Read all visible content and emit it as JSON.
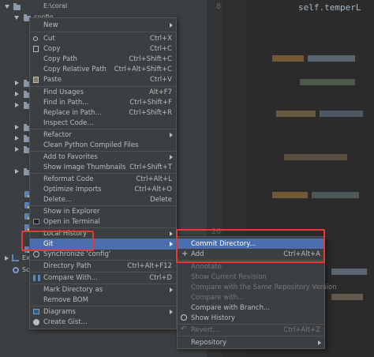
{
  "tree": {
    "root_label": "E:\\coral",
    "folder_label": "config",
    "bottom_items": [
      "Ex",
      "Sc"
    ]
  },
  "editor": {
    "code_line": "self.temperL",
    "line_numbers": [
      "8",
      "26"
    ]
  },
  "menu": {
    "items": [
      {
        "label": "New",
        "shortcut": "",
        "submenu": true,
        "icon": ""
      },
      {
        "label": "Cut",
        "shortcut": "Ctrl+X",
        "submenu": false,
        "icon": "cut-icon"
      },
      {
        "label": "Copy",
        "shortcut": "Ctrl+C",
        "submenu": false,
        "icon": "copy-icon"
      },
      {
        "label": "Copy Path",
        "shortcut": "Ctrl+Shift+C",
        "submenu": false,
        "icon": ""
      },
      {
        "label": "Copy Relative Path",
        "shortcut": "Ctrl+Alt+Shift+C",
        "submenu": false,
        "icon": ""
      },
      {
        "label": "Paste",
        "shortcut": "Ctrl+V",
        "submenu": false,
        "icon": "paste-icon"
      },
      {
        "label": "Find Usages",
        "shortcut": "Alt+F7",
        "submenu": false,
        "icon": ""
      },
      {
        "label": "Find in Path...",
        "shortcut": "Ctrl+Shift+F",
        "submenu": false,
        "icon": ""
      },
      {
        "label": "Replace in Path...",
        "shortcut": "Ctrl+Shift+R",
        "submenu": false,
        "icon": ""
      },
      {
        "label": "Inspect Code...",
        "shortcut": "",
        "submenu": false,
        "icon": ""
      },
      {
        "label": "Refactor",
        "shortcut": "",
        "submenu": true,
        "icon": ""
      },
      {
        "label": "Clean Python Compiled Files",
        "shortcut": "",
        "submenu": false,
        "icon": ""
      },
      {
        "label": "Add to Favorites",
        "shortcut": "",
        "submenu": true,
        "icon": ""
      },
      {
        "label": "Show Image Thumbnails",
        "shortcut": "Ctrl+Shift+T",
        "submenu": false,
        "icon": ""
      },
      {
        "label": "Reformat Code",
        "shortcut": "Ctrl+Alt+L",
        "submenu": false,
        "icon": ""
      },
      {
        "label": "Optimize Imports",
        "shortcut": "Ctrl+Alt+O",
        "submenu": false,
        "icon": ""
      },
      {
        "label": "Delete...",
        "shortcut": "Delete",
        "submenu": false,
        "icon": ""
      },
      {
        "label": "Show in Explorer",
        "shortcut": "",
        "submenu": false,
        "icon": ""
      },
      {
        "label": "Open in Terminal",
        "shortcut": "",
        "submenu": false,
        "icon": "terminal-icon"
      },
      {
        "label": "Local History",
        "shortcut": "",
        "submenu": true,
        "icon": ""
      },
      {
        "label": "Git",
        "shortcut": "",
        "submenu": true,
        "icon": ""
      },
      {
        "label": "Synchronize 'config'",
        "shortcut": "",
        "submenu": false,
        "icon": "sync-icon"
      },
      {
        "label": "Directory Path",
        "shortcut": "Ctrl+Alt+F12",
        "submenu": false,
        "icon": ""
      },
      {
        "label": "Compare With...",
        "shortcut": "Ctrl+D",
        "submenu": false,
        "icon": "compare-icon"
      },
      {
        "label": "Mark Directory as",
        "shortcut": "",
        "submenu": true,
        "icon": ""
      },
      {
        "label": "Remove BOM",
        "shortcut": "",
        "submenu": false,
        "icon": ""
      },
      {
        "label": "Diagrams",
        "shortcut": "",
        "submenu": true,
        "icon": "diagram-icon"
      },
      {
        "label": "Create Gist...",
        "shortcut": "",
        "submenu": false,
        "icon": "github-icon"
      }
    ]
  },
  "git_submenu": {
    "items": [
      {
        "label": "Commit Directory...",
        "shortcut": "",
        "submenu": false,
        "disabled": false,
        "icon": ""
      },
      {
        "label": "Add",
        "shortcut": "Ctrl+Alt+A",
        "submenu": false,
        "disabled": false,
        "icon": "plus-icon"
      },
      {
        "label": "Annotate",
        "shortcut": "",
        "submenu": false,
        "disabled": true,
        "icon": ""
      },
      {
        "label": "Show Current Revision",
        "shortcut": "",
        "submenu": false,
        "disabled": true,
        "icon": ""
      },
      {
        "label": "Compare with the Same Repository Version",
        "shortcut": "",
        "submenu": false,
        "disabled": true,
        "icon": ""
      },
      {
        "label": "Compare with...",
        "shortcut": "",
        "submenu": false,
        "disabled": true,
        "icon": ""
      },
      {
        "label": "Compare with Branch...",
        "shortcut": "",
        "submenu": false,
        "disabled": false,
        "icon": ""
      },
      {
        "label": "Show History",
        "shortcut": "",
        "submenu": false,
        "disabled": false,
        "icon": "history-icon"
      },
      {
        "label": "Revert...",
        "shortcut": "Ctrl+Alt+Z",
        "submenu": false,
        "disabled": true,
        "icon": "revert-icon"
      },
      {
        "label": "Repository",
        "shortcut": "",
        "submenu": true,
        "disabled": false,
        "icon": ""
      }
    ]
  },
  "colors": {
    "highlight": "#4b6eaf",
    "annotation_red": "#e53935",
    "menu_bg": "#3c3f41",
    "editor_bg": "#2b2b2b"
  }
}
